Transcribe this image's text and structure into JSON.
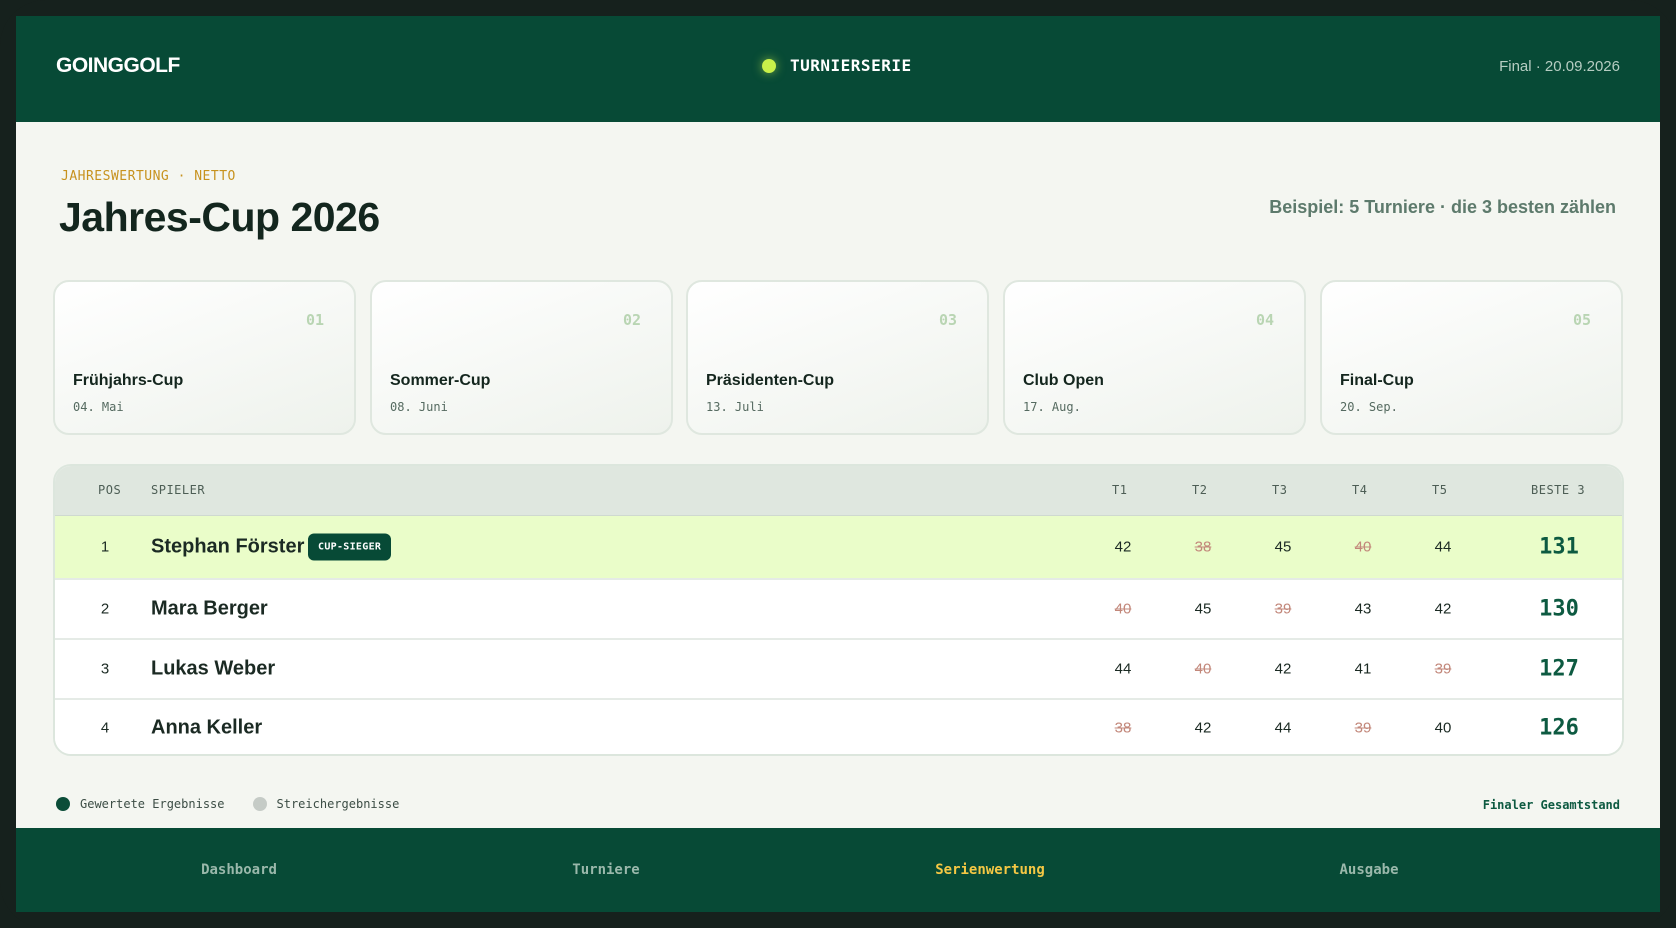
{
  "header": {
    "brand": "GOINGGOLF",
    "series_label": "TURNIERSERIE",
    "status": "Final · 20.09.2026"
  },
  "page": {
    "eyebrow": "JAHRESWERTUNG · NETTO",
    "title": "Jahres-Cup 2026",
    "note": "Beispiel: 5 Turniere · die 3 besten zählen"
  },
  "tournaments": [
    {
      "num": "01",
      "name": "Frühjahrs-Cup",
      "date": "04. Mai"
    },
    {
      "num": "02",
      "name": "Sommer-Cup",
      "date": "08. Juni"
    },
    {
      "num": "03",
      "name": "Präsidenten-Cup",
      "date": "13. Juli"
    },
    {
      "num": "04",
      "name": "Club Open",
      "date": "17. Aug."
    },
    {
      "num": "05",
      "name": "Final-Cup",
      "date": "20. Sep."
    }
  ],
  "table": {
    "headers": {
      "pos": "POS",
      "player": "SPIELER",
      "t1": "T1",
      "t2": "T2",
      "t3": "T3",
      "t4": "T4",
      "t5": "T5",
      "best": "BESTE 3"
    },
    "rows": [
      {
        "pos": "1",
        "player": "Stephan Förster",
        "badge": "CUP-SIEGER",
        "scores": [
          "42",
          "38",
          "45",
          "40",
          "44"
        ],
        "dropped": [
          false,
          true,
          false,
          true,
          false
        ],
        "best": "131"
      },
      {
        "pos": "2",
        "player": "Mara Berger",
        "badge": "",
        "scores": [
          "40",
          "45",
          "39",
          "43",
          "42"
        ],
        "dropped": [
          true,
          false,
          true,
          false,
          false
        ],
        "best": "130"
      },
      {
        "pos": "3",
        "player": "Lukas Weber",
        "badge": "",
        "scores": [
          "44",
          "40",
          "42",
          "41",
          "39"
        ],
        "dropped": [
          false,
          true,
          false,
          false,
          true
        ],
        "best": "127"
      },
      {
        "pos": "4",
        "player": "Anna Keller",
        "badge": "",
        "scores": [
          "38",
          "42",
          "44",
          "39",
          "40"
        ],
        "dropped": [
          true,
          false,
          false,
          true,
          false
        ],
        "best": "126"
      }
    ]
  },
  "legend": {
    "counted": "Gewertete Ergebnisse",
    "counted_color": "#0b4d38",
    "dropped": "Streichergebnisse",
    "dropped_color": "#c5cbc6",
    "final": "Finaler Gesamtstand"
  },
  "nav": {
    "items": [
      "Dashboard",
      "Turniere",
      "Serienwertung",
      "Ausgabe"
    ],
    "active": "Serienwertung"
  },
  "colors": {
    "primary": "#074a36",
    "accent_lime": "#c8f04a",
    "leader_row": "#eafdc9",
    "eyebrow": "#c7921e",
    "nav_active": "#f4c744"
  }
}
